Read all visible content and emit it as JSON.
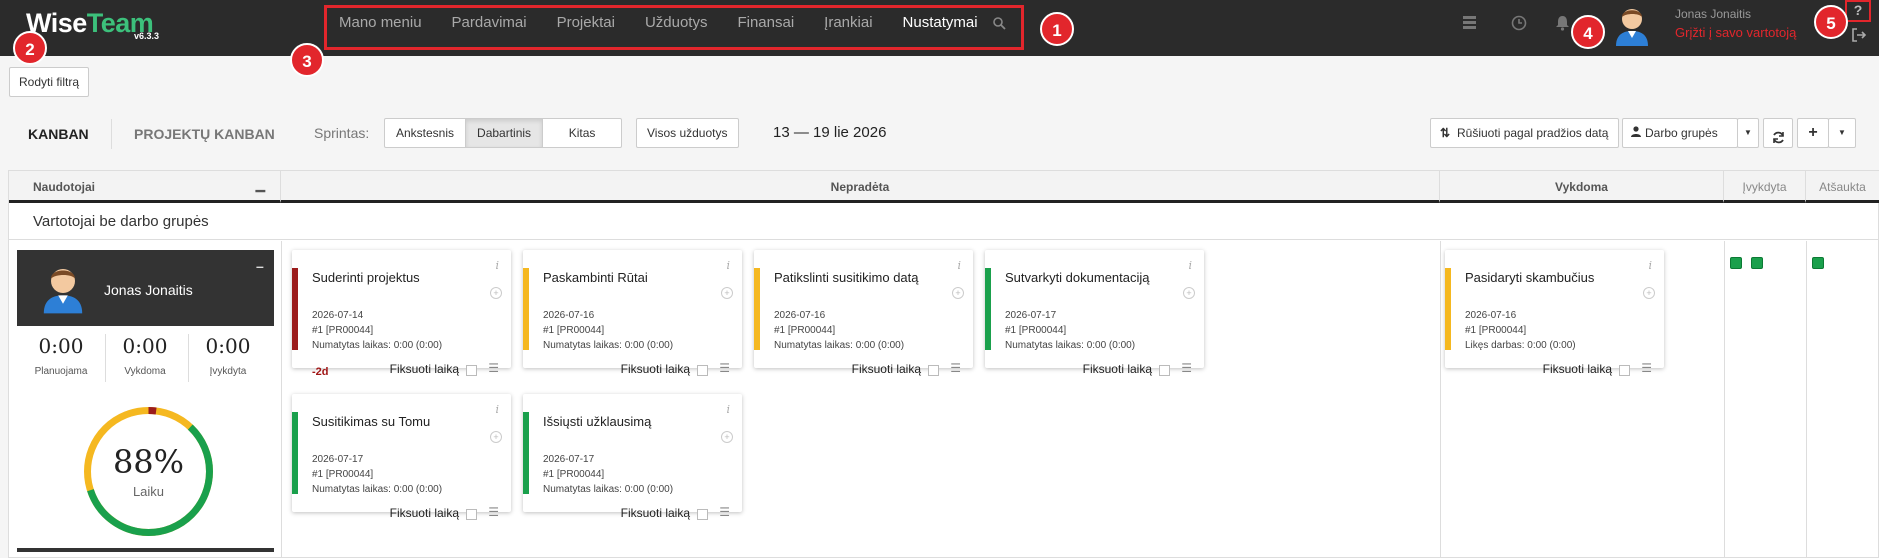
{
  "logo": {
    "wise": "Wise",
    "team": "Team",
    "version": "v6.3.3"
  },
  "nav": {
    "items": [
      {
        "label": "Mano meniu",
        "active": false
      },
      {
        "label": "Pardavimai",
        "active": false
      },
      {
        "label": "Projektai",
        "active": false
      },
      {
        "label": "Užduotys",
        "active": false
      },
      {
        "label": "Finansai",
        "active": false
      },
      {
        "label": "Įrankiai",
        "active": false
      },
      {
        "label": "Nustatymai",
        "active": true
      }
    ]
  },
  "user": {
    "name": "Jonas Jonaitis",
    "switch_link": "Grįžti į savo vartotoją"
  },
  "markers": [
    "1",
    "2",
    "3",
    "4",
    "5"
  ],
  "filter_button": "Rodyti filtrą",
  "toolbar": {
    "tab_kanban": "KANBAN",
    "tab_project_kanban": "PROJEKTŲ KANBAN",
    "sprint_label": "Sprintas:",
    "sprint_options": [
      "Ankstesnis",
      "Dabartinis",
      "Kitas"
    ],
    "sprint_selected": "Dabartinis",
    "all_tasks": "Visos užduotys",
    "date_range": "13 — 19 lie 2026",
    "sort_button": "Rūšiuoti pagal pradžios datą",
    "work_groups": "Darbo grupės"
  },
  "board": {
    "columns": [
      "Naudotojai",
      "Nepradėta",
      "Vykdoma",
      "Įvykdyta",
      "Atšaukta"
    ],
    "group_title": "Vartotojai be darbo grupės",
    "user_panel": {
      "name": "Jonas Jonaitis",
      "stats": [
        {
          "value": "0:00",
          "label": "Planuojama"
        },
        {
          "value": "0:00",
          "label": "Vykdoma"
        },
        {
          "value": "0:00",
          "label": "Įvykdyta"
        }
      ],
      "gauge_value": "88%",
      "gauge_label": "Laiku",
      "gauge_fraction": 0.88
    },
    "fix_label": "Fiksuoti laiką",
    "cards": [
      {
        "title": "Suderinti projektus",
        "date": "2026-07-14",
        "project": "#1 [PR00044]",
        "note": "Numatytas laikas: 0:00 (0:00)",
        "color": "#9b1c1c",
        "overdue": "-2d"
      },
      {
        "title": "Paskambinti Rūtai",
        "date": "2026-07-16",
        "project": "#1 [PR00044]",
        "note": "Numatytas laikas: 0:00 (0:00)",
        "color": "#f5b820",
        "overdue": ""
      },
      {
        "title": "Patikslinti susitikimo datą",
        "date": "2026-07-16",
        "project": "#1 [PR00044]",
        "note": "Numatytas laikas: 0:00 (0:00)",
        "color": "#f5b820",
        "overdue": ""
      },
      {
        "title": "Sutvarkyti dokumentaciją",
        "date": "2026-07-17",
        "project": "#1 [PR00044]",
        "note": "Numatytas laikas: 0:00 (0:00)",
        "color": "#1aa04c",
        "overdue": ""
      },
      {
        "title": "Susitikimas su Tomu",
        "date": "2026-07-17",
        "project": "#1 [PR00044]",
        "note": "Numatytas laikas: 0:00 (0:00)",
        "color": "#1aa04c",
        "overdue": ""
      },
      {
        "title": "Išsiųsti užklausimą",
        "date": "2026-07-17",
        "project": "#1 [PR00044]",
        "note": "Numatytas laikas: 0:00 (0:00)",
        "color": "#1aa04c",
        "overdue": ""
      },
      {
        "title": "Pasidaryti skambučius",
        "date": "2026-07-16",
        "project": "#1 [PR00044]",
        "note": "Likęs darbas: 0:00 (0:00)",
        "color": "#f5b820",
        "overdue": ""
      }
    ]
  },
  "colors": {
    "accent_red": "#e2262c",
    "green": "#1aa04c",
    "yellow": "#f5b820",
    "dark_red": "#9b1c1c",
    "topbar": "#2b2b2b"
  }
}
